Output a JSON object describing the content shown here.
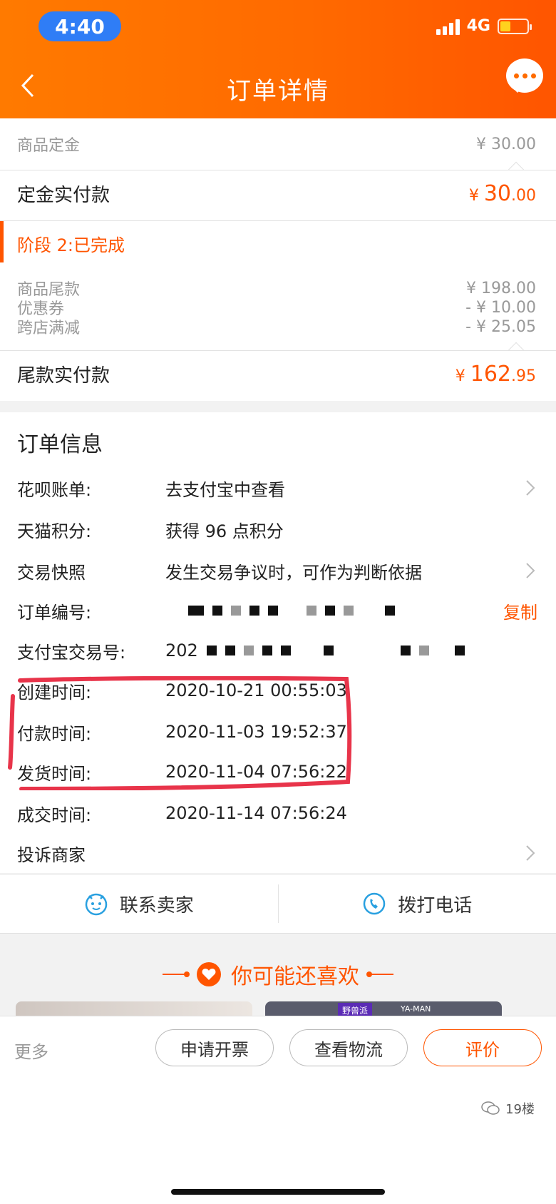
{
  "status_bar": {
    "time": "4:40",
    "network": "4G"
  },
  "header": {
    "title": "订单详情"
  },
  "deposit": {
    "goods_deposit_label": "商品定金",
    "goods_deposit_value": "¥ 30.00",
    "paid_label": "定金实付款",
    "paid_currency": "¥",
    "paid_int": "30",
    "paid_dec": ".00"
  },
  "stage2": {
    "title": "阶段 2:已完成",
    "rows": [
      {
        "label": "商品尾款",
        "value": "¥ 198.00"
      },
      {
        "label": "优惠券",
        "value": "- ¥ 10.00"
      },
      {
        "label": "跨店满减",
        "value": "- ¥ 25.05"
      }
    ],
    "paid_label": "尾款实付款",
    "paid_currency": "¥",
    "paid_int": "162",
    "paid_dec": ".95"
  },
  "order_info": {
    "title": "订单信息",
    "huabei": {
      "label": "花呗账单:",
      "value": "去支付宝中查看"
    },
    "points": {
      "label": "天猫积分:",
      "value": "获得 96 点积分"
    },
    "snapshot": {
      "label": "交易快照",
      "value": "发生交易争议时，可作为判断依据"
    },
    "order_no": {
      "label": "订单编号:",
      "copy": "复制"
    },
    "alipay_no": {
      "label": "支付宝交易号:",
      "prefix": "202"
    },
    "created": {
      "label": "创建时间:",
      "value": "2020-10-21 00:55:03"
    },
    "paid": {
      "label": "付款时间:",
      "value": "2020-11-03 19:52:37"
    },
    "shipped": {
      "label": "发货时间:",
      "value": "2020-11-04 07:56:22"
    },
    "completed": {
      "label": "成交时间:",
      "value": "2020-11-14 07:56:24"
    },
    "complain": {
      "label": "投诉商家"
    }
  },
  "contact": {
    "seller": "联系卖家",
    "phone": "拨打电话"
  },
  "recommend": {
    "title": "你可能还喜欢",
    "brand_a": "野兽派",
    "brand_b": "YA-MAN"
  },
  "bottom": {
    "more": "更多",
    "invoice": "申请开票",
    "logistics": "查看物流",
    "review": "评价",
    "watermark": "19楼"
  },
  "colors": {
    "accent": "#ff5500",
    "header": "#ff6a00",
    "highlight": "#e8344a"
  }
}
